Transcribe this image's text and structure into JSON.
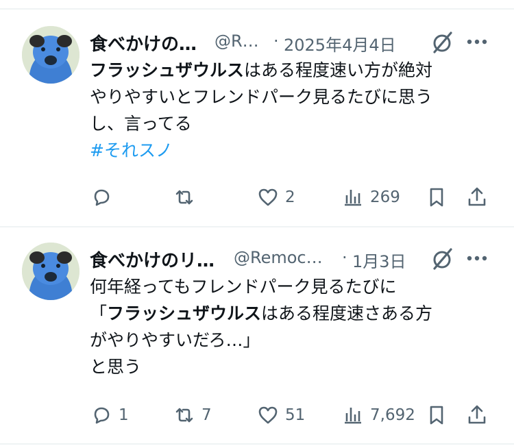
{
  "tweets": [
    {
      "name": "食べかけの…",
      "handle": "@R…",
      "separator": "·",
      "date": "2025年4月4日",
      "lines": [
        {
          "bold": "フラッシュザウルス",
          "rest": "はある程度速い方が絶対"
        },
        {
          "text": "やりやすいとフレンドパーク見るたびに思う"
        },
        {
          "text": "し、言ってる"
        }
      ],
      "hashtag": "#それスノ",
      "actions": {
        "reply": "",
        "retweet": "",
        "like": "2",
        "views": "269"
      }
    },
    {
      "name": "食べかけのリ…",
      "handle": "@Remoc…",
      "separator": "·",
      "date": "1月3日",
      "lines": [
        {
          "text": "何年経ってもフレンドパーク見るたびに"
        },
        {
          "prefix": "「",
          "bold": "フラッシュザウルス",
          "rest": "はある程度速さある方"
        },
        {
          "text": "がやりやすいだろ…」"
        },
        {
          "text": "と思う"
        }
      ],
      "actions": {
        "reply": "1",
        "retweet": "7",
        "like": "51",
        "views": "7,692"
      }
    }
  ],
  "icons": {
    "grok": "grok-icon",
    "more": "more-icon",
    "reply": "reply-icon",
    "retweet": "retweet-icon",
    "like": "like-icon",
    "views": "views-icon",
    "bookmark": "bookmark-icon",
    "share": "share-icon"
  },
  "colors": {
    "text": "#0f1419",
    "secondary": "#536471",
    "link": "#1d9bf0",
    "divider": "#eff3f4"
  }
}
